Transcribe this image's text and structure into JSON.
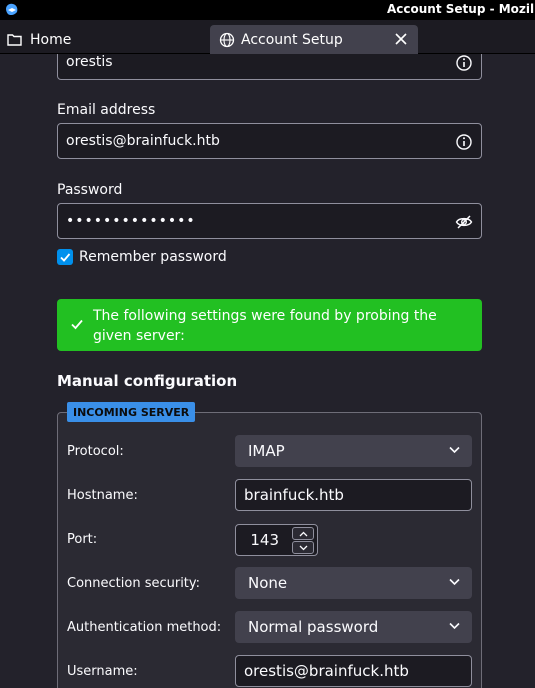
{
  "window": {
    "title": "Account Setup - Mozilla Th"
  },
  "tabs": [
    {
      "label": "Home"
    },
    {
      "label": "Account Setup"
    }
  ],
  "form": {
    "name_value": "orestis",
    "email_label": "Email address",
    "email_value": "orestis@brainfuck.htb",
    "password_label": "Password",
    "password_value": "••••••••••••••",
    "remember_label": "Remember password",
    "remember_checked": true
  },
  "notice": {
    "text": "The following settings were found by probing the given server:"
  },
  "manual": {
    "title": "Manual configuration",
    "incoming": {
      "badge": "INCOMING SERVER",
      "protocol_label": "Protocol:",
      "protocol_value": "IMAP",
      "hostname_label": "Hostname:",
      "hostname_value": "brainfuck.htb",
      "port_label": "Port:",
      "port_value": "143",
      "security_label": "Connection security:",
      "security_value": "None",
      "auth_label": "Authentication method:",
      "auth_value": "Normal password",
      "username_label": "Username:",
      "username_value": "orestis@brainfuck.htb"
    }
  },
  "colors": {
    "accent_green": "#22c022",
    "badge_blue": "#3a8fe8",
    "checkbox_blue": "#0090ed"
  }
}
